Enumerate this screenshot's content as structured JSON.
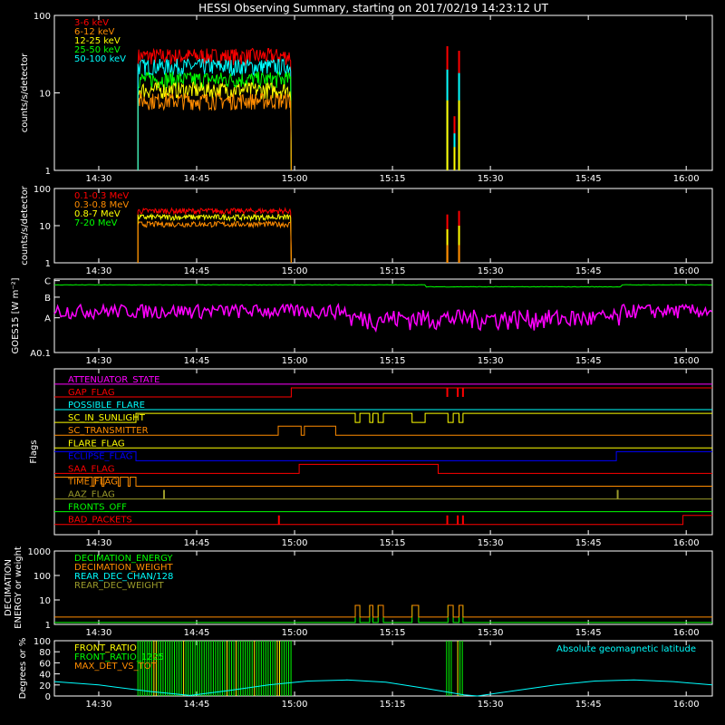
{
  "title": "HESSI Observing Summary, starting on 2017/02/19 14:23:12 UT",
  "time_ticks": [
    "14:30",
    "14:45",
    "15:00",
    "15:15",
    "15:30",
    "15:45",
    "16:00"
  ],
  "time_tick_minutes": [
    30,
    45,
    60,
    75,
    90,
    105,
    120
  ],
  "time_range_minutes": [
    23.2,
    124
  ],
  "colors": {
    "background": "#000000",
    "axes": "#ffffff",
    "red": "#ff0000",
    "orange": "#ff8c00",
    "yellow": "#ffff00",
    "green": "#00ff00",
    "cyan": "#00ffff",
    "magenta": "#ff00ff",
    "blue": "#0000ff",
    "olive": "#9a9a2a",
    "dark_orange": "#e07020",
    "brownish": "#c08040"
  },
  "chart_data": [
    {
      "id": "panel1",
      "type": "area",
      "ylabel": "counts/s/detector",
      "yscale": "log",
      "ylim": [
        1,
        100
      ],
      "y_tick_labels": [
        "1",
        "10",
        "100"
      ],
      "legend": [
        "3-6 keV",
        "6-12 keV",
        "12-25 keV",
        "25-50 keV",
        "50-100 keV"
      ],
      "legend_colors": [
        "#ff0000",
        "#ff8c00",
        "#ffff00",
        "#00ff00",
        "#00ffff"
      ],
      "observation_interval_minutes": [
        36.0,
        59.5
      ],
      "series": [
        {
          "name": "3-6 keV",
          "color": "#ff0000",
          "level": 30
        },
        {
          "name": "50-100 keV",
          "color": "#00ffff",
          "level": 22
        },
        {
          "name": "25-50 keV",
          "color": "#00ff00",
          "level": 15
        },
        {
          "name": "12-25 keV",
          "color": "#ffff00",
          "level": 11
        },
        {
          "name": "6-12 keV",
          "color": "#ff8c00",
          "level": 8
        }
      ],
      "spikes": [
        {
          "t": 83.4,
          "values": [
            40,
            20,
            8
          ]
        },
        {
          "t": 84.5,
          "values": [
            5,
            3,
            2
          ]
        },
        {
          "t": 85.2,
          "values": [
            35,
            18,
            8
          ]
        }
      ]
    },
    {
      "id": "panel2",
      "type": "area",
      "ylabel": "counts/s/detector",
      "yscale": "log",
      "ylim": [
        1,
        100
      ],
      "y_tick_labels": [
        "1",
        "10",
        "100"
      ],
      "legend": [
        "0.1-0.3 MeV",
        "0.3-0.8 MeV",
        "0.8-7 MeV",
        "7-20 MeV"
      ],
      "legend_colors": [
        "#ff0000",
        "#ff8c00",
        "#ffff00",
        "#00ff00"
      ],
      "observation_interval_minutes": [
        36.0,
        59.5
      ],
      "series": [
        {
          "name": "0.1-0.3 MeV",
          "color": "#ff0000",
          "level": 25
        },
        {
          "name": "0.8-7 MeV",
          "color": "#ffff00",
          "level": 17
        },
        {
          "name": "0.3-0.8 MeV",
          "color": "#ff8c00",
          "level": 11
        }
      ],
      "spikes": [
        {
          "t": 83.4,
          "values": [
            20,
            8,
            3
          ]
        },
        {
          "t": 85.2,
          "values": [
            25,
            10,
            3
          ]
        }
      ]
    },
    {
      "id": "panel3",
      "type": "line",
      "ylabel": "GOES15 [W m⁻²]",
      "y_tick_labels": [
        "A0.1",
        "A",
        "B",
        "C"
      ],
      "ylim": [
        0.1,
        3
      ],
      "series": [
        {
          "name": "GOES long",
          "color": "#00ff00",
          "level": 2.3
        },
        {
          "name": "GOES short",
          "color": "#ff00ff",
          "level": 0.7
        }
      ]
    },
    {
      "id": "panel4",
      "type": "line",
      "ylabel": "Flags",
      "flags": [
        {
          "name": "ATTENUATOR_STATE",
          "color": "#ff00ff",
          "high": []
        },
        {
          "name": "GAP_FLAG",
          "color": "#ff0000",
          "high": [
            [
              59.5,
              124
            ]
          ],
          "spikes": [
            83.4,
            85.0,
            85.8
          ]
        },
        {
          "name": "POSSIBLE_FLARE",
          "color": "#00ffff",
          "high": []
        },
        {
          "name": "SC_IN_SUNLIGHT",
          "color": "#ffff00",
          "high": [
            [
              35.7,
              124
            ]
          ],
          "drops": [
            [
              69.3,
              70.0
            ],
            [
              71.5,
              72.0
            ],
            [
              72.8,
              73.6
            ],
            [
              78.0,
              80.0
            ],
            [
              83.5,
              84.3
            ],
            [
              85.2,
              85.8
            ]
          ]
        },
        {
          "name": "SC_TRANSMITTER",
          "color": "#ff8c00",
          "high": [
            [
              57.5,
              61
            ],
            [
              61.5,
              66.3
            ]
          ]
        },
        {
          "name": "FLARE_FLAG",
          "color": "#ffff00",
          "high": []
        },
        {
          "name": "ECLIPSE_FLAG",
          "color": "#0000ff",
          "high": [
            [
              23.2,
              35.7
            ],
            [
              109.3,
              124
            ]
          ]
        },
        {
          "name": "SAA_FLAG",
          "color": "#ff0000",
          "high": [
            [
              60.7,
              82.0
            ]
          ]
        },
        {
          "name": "TIME_FLAG",
          "color": "#ff8c00",
          "high": [
            [
              23.2,
              35.7
            ]
          ],
          "drops": [
            [
              29,
              29.3
            ],
            [
              30.5,
              30.8
            ],
            [
              33,
              33.3
            ],
            [
              34.5,
              34.8
            ],
            [
              36.5,
              36.8
            ],
            [
              38,
              38.3
            ],
            [
              39.2,
              39.5
            ],
            [
              69.5,
              69.8
            ],
            [
              76.8,
              77.1
            ],
            [
              78,
              78.3
            ],
            [
              80.5,
              80.8
            ],
            [
              86,
              86.3
            ]
          ]
        },
        {
          "name": "AAZ_FLAG",
          "color": "#9a9a2a",
          "high": [],
          "spikes": [
            40.0,
            109.5
          ]
        },
        {
          "name": "FRONTS_OFF",
          "color": "#00ff00",
          "high": []
        },
        {
          "name": "BAD_PACKETS",
          "color": "#ff0000",
          "high": [
            [
              119.5,
              124
            ]
          ],
          "spikes": [
            57.6,
            83.4,
            85.0,
            85.8
          ]
        }
      ]
    },
    {
      "id": "panel5",
      "type": "line",
      "ylabel": "DECIMATION ENERGY or weight",
      "yscale": "log",
      "ylim": [
        1,
        1000
      ],
      "y_tick_labels": [
        "1",
        "10",
        "100",
        "1000"
      ],
      "legend": [
        "DECIMATION_ENERGY",
        "DECIMATION_WEIGHT",
        "REAR_DEC_CHAN/128",
        "REAR_DEC_WEIGHT"
      ],
      "legend_colors": [
        "#00ff00",
        "#ff8c00",
        "#00ffff",
        "#9a9a2a"
      ],
      "series": [
        {
          "name": "DECIMATION_ENERGY",
          "color": "#00ff00",
          "baseline": 1.2,
          "high": 6,
          "high_intervals": [
            [
              69.3,
              70.0
            ],
            [
              71.5,
              72.0
            ],
            [
              72.8,
              73.6
            ],
            [
              78.0,
              79.0
            ],
            [
              83.5,
              84.3
            ],
            [
              85.2,
              85.8
            ]
          ]
        },
        {
          "name": "DECIMATION_WEIGHT",
          "color": "#ff8c00",
          "baseline": 2,
          "high": 6,
          "high_intervals": [
            [
              69.3,
              70.0
            ],
            [
              71.5,
              72.0
            ],
            [
              72.8,
              73.6
            ],
            [
              78.0,
              79.0
            ],
            [
              83.5,
              84.3
            ],
            [
              85.2,
              85.8
            ]
          ]
        }
      ]
    },
    {
      "id": "panel6",
      "type": "line",
      "ylabel": "Degrees or %",
      "ylim": [
        0,
        100
      ],
      "y_tick_labels": [
        "0",
        "20",
        "40",
        "60",
        "80",
        "100"
      ],
      "legend": [
        "FRONT_RATIO",
        "FRONT_RATIO_1225",
        "MAX_DET_VS_TOT"
      ],
      "legend_colors": [
        "#ffff00",
        "#00ff00",
        "#ff8c00"
      ],
      "annotation": "Absolute geomagnetic latitude",
      "annotation_color": "#00ffff",
      "ratio_intervals": [
        [
          36.0,
          59.5
        ],
        [
          83.3,
          84.2
        ],
        [
          85.0,
          85.8
        ]
      ],
      "latitude": [
        {
          "t": 23.2,
          "v": 26
        },
        {
          "t": 30,
          "v": 20
        },
        {
          "t": 38,
          "v": 8
        },
        {
          "t": 44,
          "v": 1
        },
        {
          "t": 50,
          "v": 10
        },
        {
          "t": 56,
          "v": 20
        },
        {
          "t": 62,
          "v": 27
        },
        {
          "t": 68,
          "v": 29
        },
        {
          "t": 74,
          "v": 25
        },
        {
          "t": 80,
          "v": 14
        },
        {
          "t": 86,
          "v": 2
        },
        {
          "t": 88,
          "v": 0
        },
        {
          "t": 94,
          "v": 10
        },
        {
          "t": 100,
          "v": 20
        },
        {
          "t": 106,
          "v": 27
        },
        {
          "t": 112,
          "v": 29
        },
        {
          "t": 118,
          "v": 26
        },
        {
          "t": 124,
          "v": 20
        }
      ]
    }
  ]
}
